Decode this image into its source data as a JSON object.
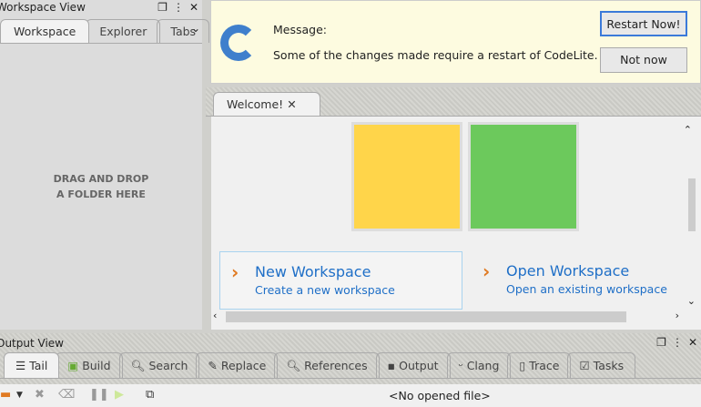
{
  "workspace_view": {
    "title": "Workspace View",
    "tabs": [
      "Workspace",
      "Explorer",
      "Tabs"
    ],
    "empty_text_1": "DRAG AND DROP",
    "empty_text_2": "A FOLDER HERE"
  },
  "message": {
    "label": "Message:",
    "text": "Some of the changes made require a restart of CodeLite.",
    "restart_button": "Restart Now!",
    "not_now_button": "Not now"
  },
  "editor": {
    "tabs": [
      "Welcome!"
    ],
    "new_workspace": {
      "title": "New Workspace",
      "subtitle": "Create a new workspace"
    },
    "open_workspace": {
      "title": "Open Workspace",
      "subtitle": "Open an existing workspace"
    }
  },
  "output_view": {
    "title": "Output View",
    "tabs": [
      "Tail",
      "Build",
      "Search",
      "Replace",
      "References",
      "Output",
      "Clang",
      "Trace",
      "Tasks"
    ],
    "status": "<No opened file>"
  },
  "colors": {
    "accent": "#3b7ad9",
    "yellow": "#ffd54a",
    "green": "#6cc95c"
  }
}
